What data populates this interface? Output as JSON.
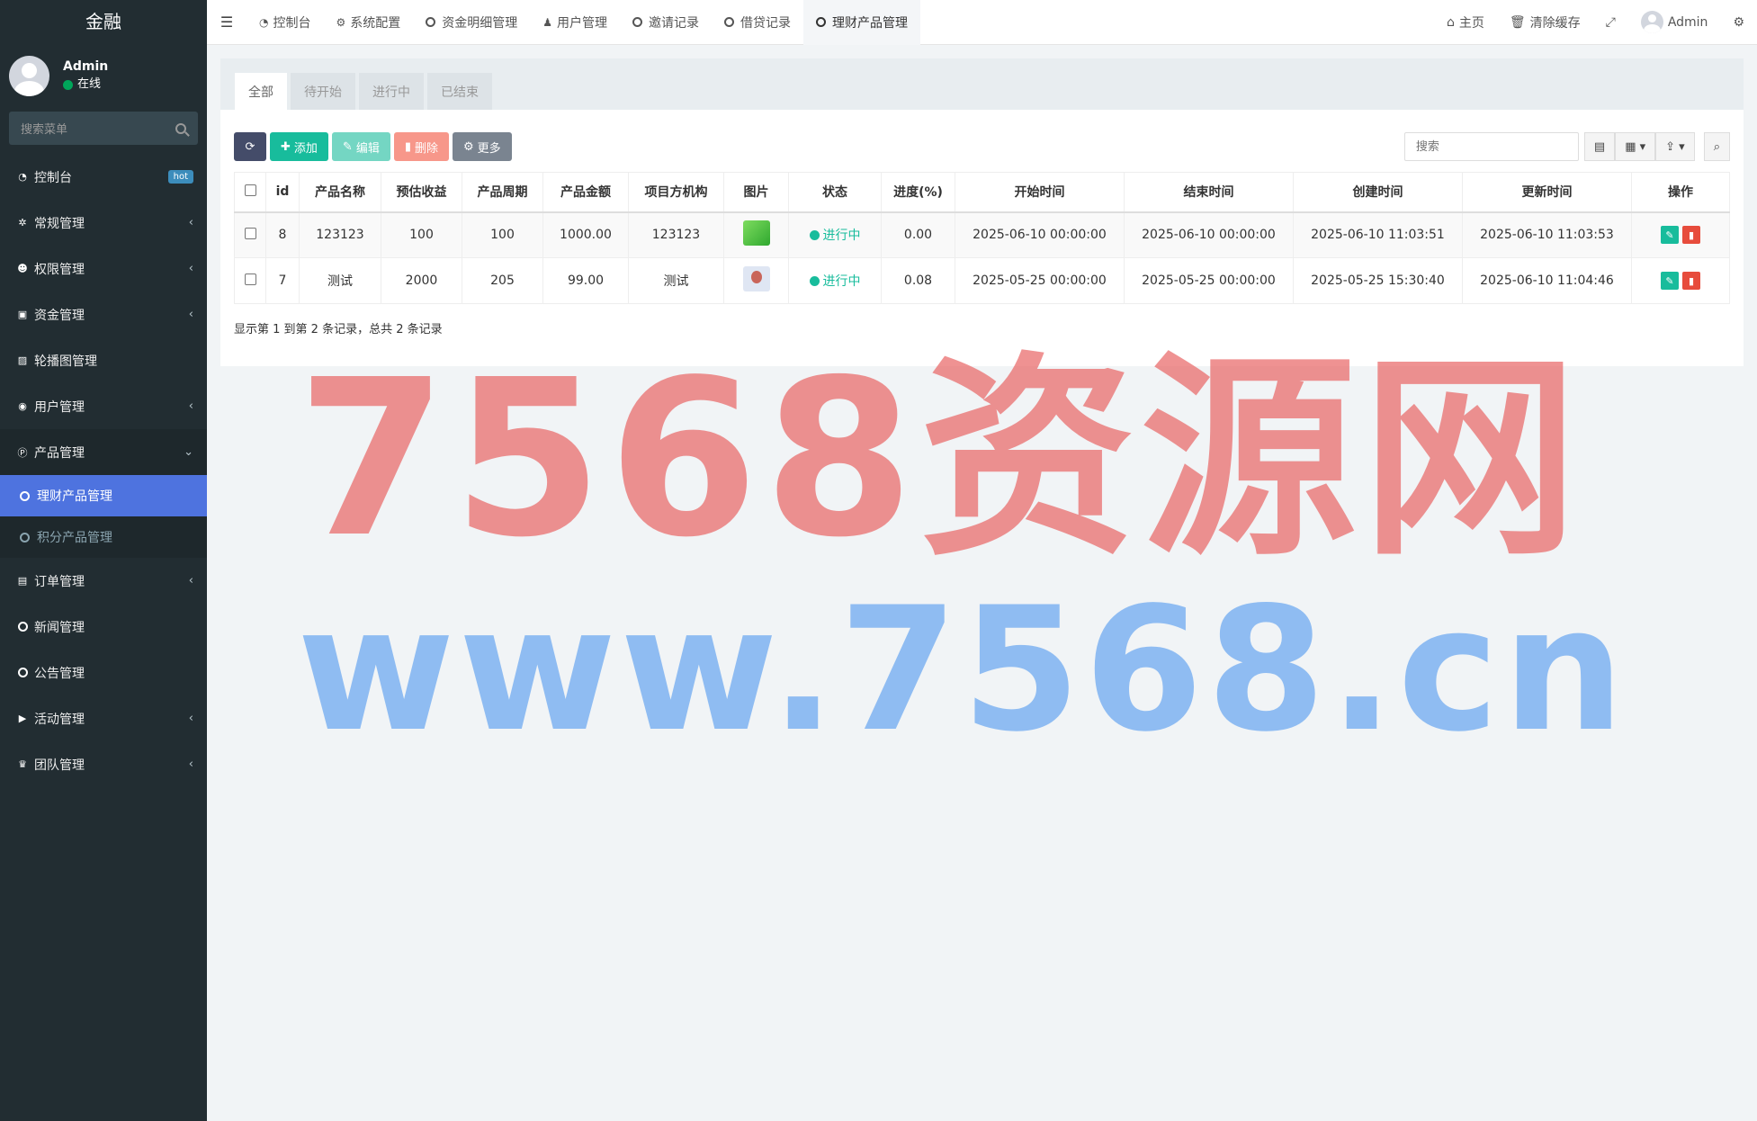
{
  "brand": "金融",
  "user": {
    "name": "Admin",
    "status": "在线"
  },
  "sidebar_search_placeholder": "搜索菜单",
  "menu": [
    {
      "label": "控制台",
      "icon": "dashboard-icon",
      "badge": "hot"
    },
    {
      "label": "常规管理",
      "icon": "cogs-icon"
    },
    {
      "label": "权限管理",
      "icon": "group-icon"
    },
    {
      "label": "资金管理",
      "icon": "money-icon"
    },
    {
      "label": "轮播图管理",
      "icon": "image-icon"
    },
    {
      "label": "用户管理",
      "icon": "user-circle-icon"
    },
    {
      "label": "产品管理",
      "icon": "product-icon"
    }
  ],
  "submenu": [
    {
      "label": "理财产品管理"
    },
    {
      "label": "积分产品管理"
    }
  ],
  "menu_after": [
    {
      "label": "订单管理",
      "icon": "list-icon"
    },
    {
      "label": "新闻管理",
      "icon": "circle-icon"
    },
    {
      "label": "公告管理",
      "icon": "circle-icon"
    },
    {
      "label": "活动管理",
      "icon": "play-icon"
    },
    {
      "label": "团队管理",
      "icon": "trophy-icon"
    }
  ],
  "header_tabs": [
    "控制台",
    "系统配置",
    "资金明细管理",
    "用户管理",
    "邀请记录",
    "借贷记录",
    "理财产品管理"
  ],
  "header_right": {
    "home": "主页",
    "clear_cache": "清除缓存",
    "admin": "Admin"
  },
  "panel_tabs": [
    "全部",
    "待开始",
    "进行中",
    "已结束"
  ],
  "toolbar": {
    "add": "添加",
    "edit": "编辑",
    "delete": "删除",
    "more": "更多",
    "search_placeholder": "搜索"
  },
  "table": {
    "columns": [
      "id",
      "产品名称",
      "预估收益",
      "产品周期",
      "产品金额",
      "项目方机构",
      "图片",
      "状态",
      "进度(%)",
      "开始时间",
      "结束时间",
      "创建时间",
      "更新时间",
      "操作"
    ],
    "rows": [
      {
        "id": "8",
        "name": "123123",
        "income": "100",
        "period": "100",
        "amount": "1000.00",
        "org": "123123",
        "status": "进行中",
        "progress": "0.00",
        "start": "2025-06-10 00:00:00",
        "end": "2025-06-10 00:00:00",
        "created": "2025-06-10 11:03:51",
        "updated": "2025-06-10 11:03:53"
      },
      {
        "id": "7",
        "name": "测试",
        "income": "2000",
        "period": "205",
        "amount": "99.00",
        "org": "测试",
        "status": "进行中",
        "progress": "0.08",
        "start": "2025-05-25 00:00:00",
        "end": "2025-05-25 00:00:00",
        "created": "2025-05-25 15:30:40",
        "updated": "2025-06-10 11:04:46"
      }
    ]
  },
  "pagination_info": "显示第 1 到第 2 条记录，总共 2 条记录",
  "watermark": {
    "line1": "7568资源网",
    "line2": "www.7568.cn"
  }
}
